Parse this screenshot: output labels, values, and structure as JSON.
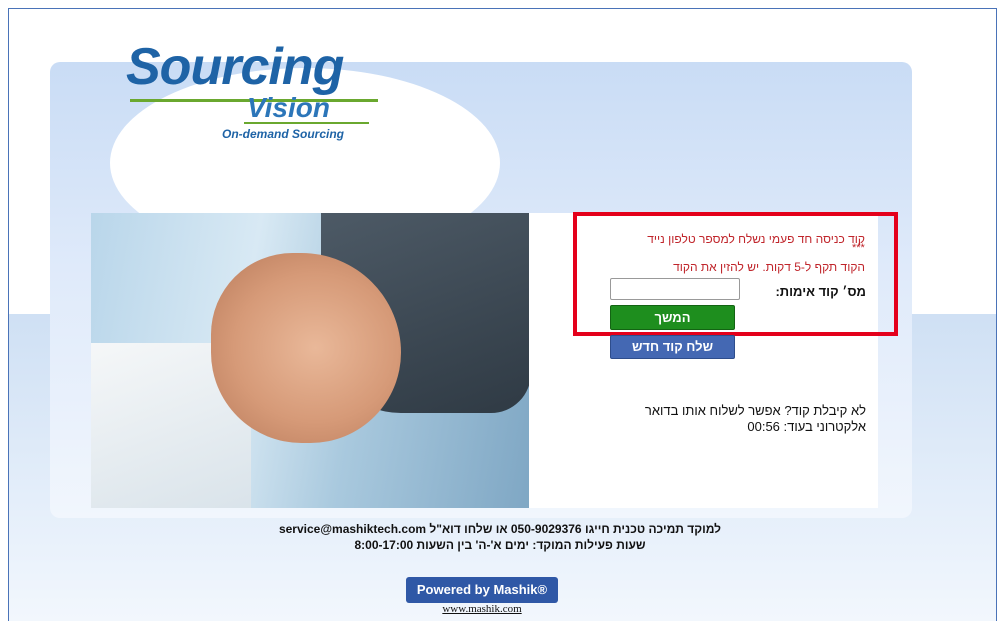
{
  "logo": {
    "name": "Sourcing",
    "sub": "Vision",
    "tagline": "On-demand Sourcing"
  },
  "login": {
    "message_line1": "קוד כניסה חד פעמי נשלח למספר טלפון נייד",
    "masked_phone": "***",
    "message_line2": "הקוד תקף ל-5 דקות. יש להזין את הקוד",
    "code_label": "מס׳ קוד אימות:",
    "code_value": "",
    "continue_label": "המשך",
    "resend_label": "שלח קוד חדש",
    "no_code_text": "לא קיבלת קוד? אפשר לשלוח אותו בדואר אלקטרוני בעוד: 00:56"
  },
  "footer": {
    "support_line1": "למוקד תמיכה טכנית חייגו 050-9029376 או שלחו דוא\"ל service@mashiktech.com",
    "support_line2": "שעות פעילות המוקד: ימים א'-ה' בין השעות 8:00-17:00",
    "powered_label": "Powered by Mashik®",
    "site_link": "www.mashik.com"
  },
  "colors": {
    "error_text": "#c0252b",
    "highlight_border": "#e4001b",
    "continue_button": "#1e8e1e",
    "resend_button": "#4468b3",
    "brand_blue": "#1e63a6",
    "brand_green": "#6aa82f"
  },
  "icons": {
    "hero_image": "handshake-photo"
  }
}
